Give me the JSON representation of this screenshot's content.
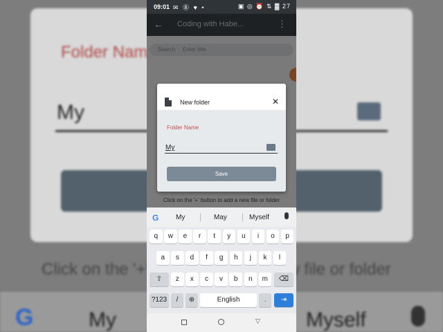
{
  "background": {
    "label": "Folder Name",
    "input_value": "My",
    "hint": "Click on the '+' button to add a new file or folder",
    "suggestions": [
      "My",
      "Myself"
    ]
  },
  "status_bar": {
    "time": "09:01",
    "left_icons": "✉ Ⓑ ♥ •",
    "right_icons": "▣ ◎ ⏰ ⇅ ▓ 27"
  },
  "app_bar": {
    "back_icon": "←",
    "title": "Coding with Habe...",
    "menu_icon": "⋮"
  },
  "search": {
    "label": "Search",
    "placeholder": "Enter title"
  },
  "hint": "Click on the '+' button to add a new file or folder",
  "dialog": {
    "title": "New folder",
    "close_icon": "✕",
    "field_label": "Folder Name",
    "field_value": "My",
    "save_label": "Save"
  },
  "keyboard": {
    "suggestions": [
      "My",
      "May",
      "Myself"
    ],
    "row1": [
      "q",
      "w",
      "e",
      "r",
      "t",
      "y",
      "u",
      "i",
      "o",
      "p"
    ],
    "row1_hints": [
      "1",
      "2",
      "3",
      "4",
      "5",
      "6",
      "7",
      "8",
      "9",
      "0"
    ],
    "row2": [
      "a",
      "s",
      "d",
      "f",
      "g",
      "h",
      "j",
      "k",
      "l"
    ],
    "row3": [
      "z",
      "x",
      "c",
      "v",
      "b",
      "n",
      "m"
    ],
    "shift_icon": "⇧",
    "backspace_icon": "⌫",
    "symbols_label": "?123",
    "slash_label": "/",
    "globe_icon": "⊕",
    "space_label": "English",
    "period_label": ".",
    "enter_icon": "⇥"
  },
  "nav": {
    "back_icon": "▽"
  },
  "colors": {
    "accent": "#2e7fd8",
    "label_red": "#c0504d",
    "app_bar": "#3c4249",
    "fab": "#f28d4e"
  }
}
